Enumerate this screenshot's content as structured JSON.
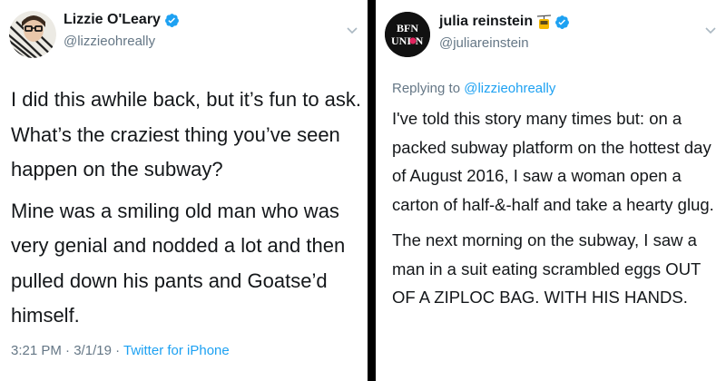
{
  "left_tweet": {
    "author_name": "Lizzie O'Leary",
    "author_handle": "@lizzieohreally",
    "paragraphs": [
      "I did this awhile back, but it’s fun to ask. What’s the craziest thing you’ve seen happen on the subway?",
      "Mine was a smiling old man who was very genial and nodded a lot and then pulled down his pants and Goatse’d himself."
    ],
    "time": "3:21 PM",
    "separator": "·",
    "date": "3/1/19",
    "source": "Twitter for iPhone"
  },
  "right_tweet": {
    "author_name": "julia reinstein",
    "author_handle": "@juliareinstein",
    "avatar_text_line1": "BFN",
    "avatar_text_line2": "UNI",
    "avatar_text_line3": "N",
    "reply_prefix": "Replying to",
    "reply_handle": "@lizzieohreally",
    "paragraphs": [
      "I've told this story many times but: on a packed subway platform on the hottest day of August 2016, I saw a woman open a carton of half-&-half and take a hearty glug.",
      "The next morning on the subway, I saw a man in a suit eating scrambled eggs OUT OF A ZIPLOC BAG. WITH HIS HANDS."
    ]
  },
  "colors": {
    "accent": "#1da1f2",
    "muted": "#657786",
    "text": "#14171a",
    "divider": "#000000"
  }
}
